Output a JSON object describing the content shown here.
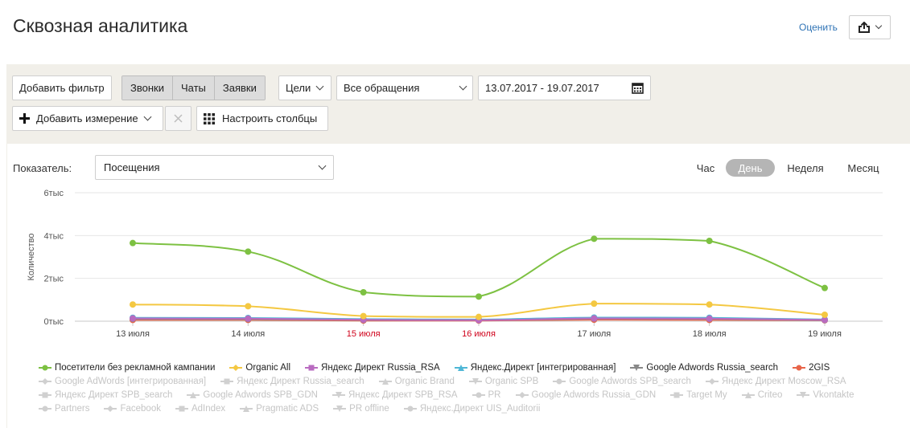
{
  "header": {
    "title": "Сквозная аналитика",
    "rate_link": "Оценить",
    "share_icon": "share-icon"
  },
  "filters": {
    "add_filter": "Добавить фильтр",
    "tabs": [
      {
        "label": "Звонки"
      },
      {
        "label": "Чаты"
      },
      {
        "label": "Заявки"
      }
    ],
    "goals": "Цели",
    "requests": "Все обращения",
    "date_range": "13.07.2017 - 19.07.2017",
    "add_dimension": "Добавить измерение",
    "configure_columns": "Настроить столбцы"
  },
  "metric": {
    "label": "Показатель:",
    "value": "Посещения"
  },
  "periods": [
    {
      "label": "Час"
    },
    {
      "label": "День",
      "active": true
    },
    {
      "label": "Неделя"
    },
    {
      "label": "Месяц"
    }
  ],
  "chart_data": {
    "type": "line",
    "ylabel": "Количество",
    "yticks": [
      "0тыс",
      "2тыс",
      "4тыс",
      "6тыс"
    ],
    "ylim": [
      0,
      6000
    ],
    "categories": [
      "13 июля",
      "14 июля",
      "15 июля",
      "16 июля",
      "17 июля",
      "18 июля",
      "19 июля"
    ],
    "weekend": [
      false,
      false,
      true,
      true,
      false,
      false,
      false
    ],
    "colors": {
      "weekend": "#d0021b",
      "grid": "#e6e6e6"
    },
    "series": [
      {
        "name": "Посетители без рекламной кампании",
        "color": "#7dc142",
        "values": [
          3650,
          3250,
          1350,
          1150,
          3850,
          3750,
          1550
        ]
      },
      {
        "name": "Organic All",
        "color": "#f4c842",
        "values": [
          780,
          700,
          240,
          200,
          820,
          780,
          300
        ]
      },
      {
        "name": "Яндекс Директ Russia_RSA",
        "color": "#b96bc0",
        "values": [
          130,
          120,
          70,
          50,
          130,
          120,
          60
        ]
      },
      {
        "name": "Яндекс.Директ [интегрированная]",
        "color": "#4fb7d6",
        "values": [
          160,
          150,
          100,
          80,
          170,
          160,
          80
        ]
      },
      {
        "name": "Google Adwords Russia_search",
        "color": "#888888",
        "values": [
          110,
          100,
          60,
          50,
          120,
          110,
          50
        ]
      },
      {
        "name": "2GIS",
        "color": "#e8654a",
        "values": [
          60,
          60,
          30,
          30,
          70,
          60,
          40
        ]
      }
    ]
  },
  "legend_rows": [
    [
      {
        "name": "Посетители без рекламной кампании",
        "color": "#7dc142",
        "marker": "circle",
        "on": true
      },
      {
        "name": "Organic All",
        "color": "#f4c842",
        "marker": "diamond",
        "on": true
      },
      {
        "name": "Яндекс Директ Russia_RSA",
        "color": "#b96bc0",
        "marker": "square",
        "on": true
      },
      {
        "name": "Яндекс.Директ [интегрированная]",
        "color": "#4fb7d6",
        "marker": "triangle",
        "on": true
      },
      {
        "name": "Google Adwords Russia_search",
        "color": "#888888",
        "marker": "triangle-down",
        "on": true
      },
      {
        "name": "2GIS",
        "color": "#e8654a",
        "marker": "circle",
        "on": true
      }
    ],
    [
      {
        "name": "Google AdWords [интегрированная]",
        "marker": "diamond",
        "on": false
      },
      {
        "name": "Яндекс Директ Russia_search",
        "marker": "square",
        "on": false
      },
      {
        "name": "Organic Brand",
        "marker": "triangle",
        "on": false
      },
      {
        "name": "Organic SPB",
        "marker": "triangle-down",
        "on": false
      },
      {
        "name": "Google Adwords SPB_search",
        "marker": "circle",
        "on": false
      },
      {
        "name": "Яндекс Директ Moscow_RSA",
        "marker": "diamond",
        "on": false
      }
    ],
    [
      {
        "name": "Яндекс Директ SPB_search",
        "marker": "square",
        "on": false
      },
      {
        "name": "Google Adwords SPB_GDN",
        "marker": "triangle",
        "on": false
      },
      {
        "name": "Яндекс Директ SPB_RSA",
        "marker": "triangle-down",
        "on": false
      },
      {
        "name": "PR",
        "marker": "circle",
        "on": false
      },
      {
        "name": "Google Adwords Russia_GDN",
        "marker": "diamond",
        "on": false
      },
      {
        "name": "Target My",
        "marker": "square",
        "on": false
      },
      {
        "name": "Criteo",
        "marker": "triangle",
        "on": false
      },
      {
        "name": "Vkontakte",
        "marker": "triangle-down",
        "on": false
      }
    ],
    [
      {
        "name": "Partners",
        "marker": "circle",
        "on": false
      },
      {
        "name": "Facebook",
        "marker": "diamond",
        "on": false
      },
      {
        "name": "AdIndex",
        "marker": "square",
        "on": false
      },
      {
        "name": "Pragmatic ADS",
        "marker": "triangle",
        "on": false
      },
      {
        "name": "PR offline",
        "marker": "triangle-down",
        "on": false
      },
      {
        "name": "Яндекс.Директ UIS_Auditorii",
        "marker": "circle",
        "on": false
      }
    ]
  ]
}
